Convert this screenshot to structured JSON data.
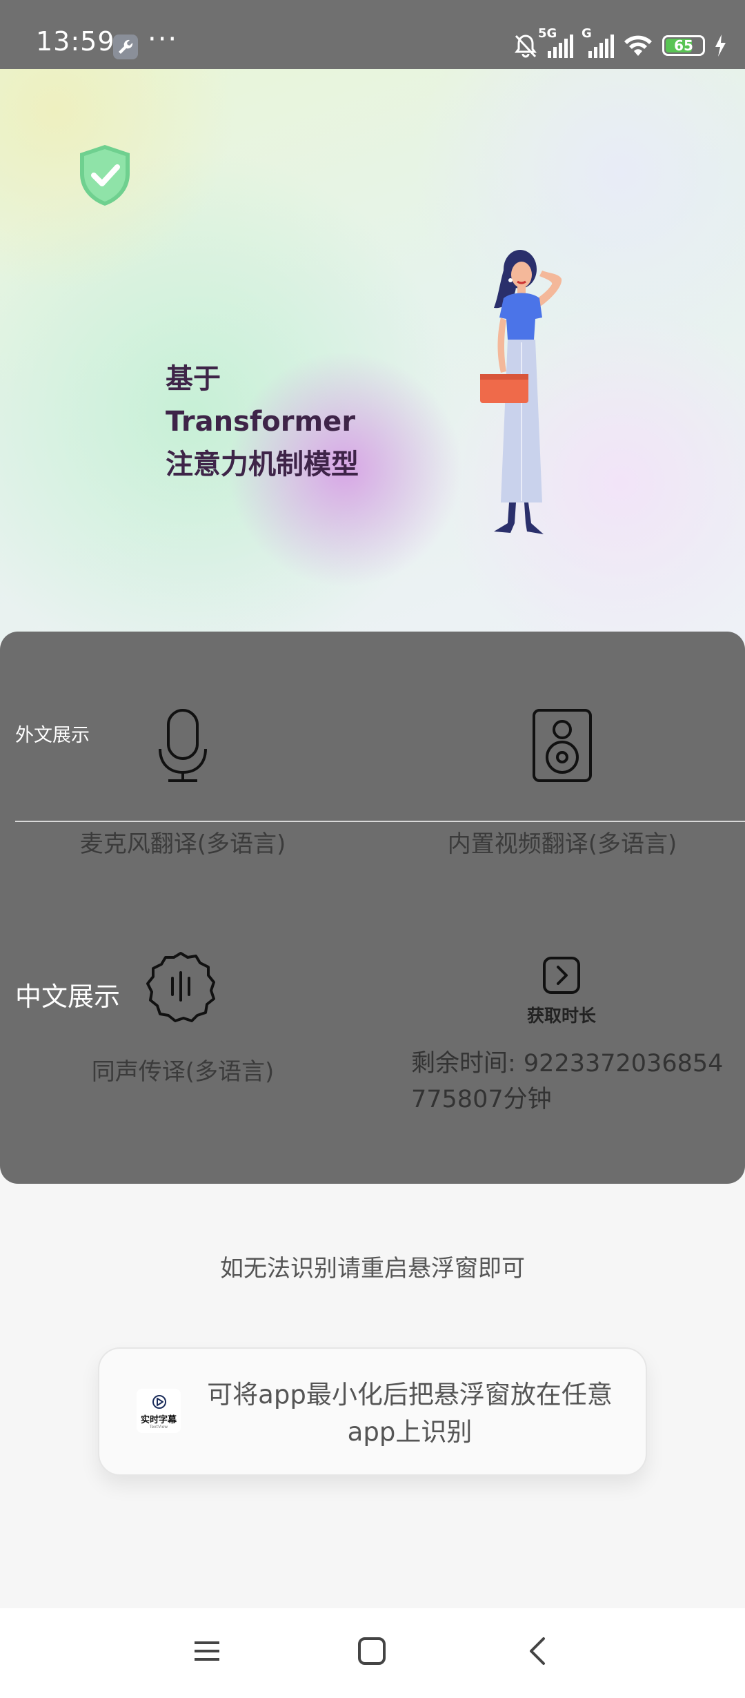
{
  "status_bar": {
    "time": "13:59",
    "network_1": "5G",
    "network_2": "G",
    "battery_level": "65",
    "icons": [
      "wrench-icon",
      "more-dots-icon",
      "mute-bell-icon",
      "signal-icon",
      "wifi-icon",
      "battery-icon",
      "charging-icon"
    ]
  },
  "hero": {
    "headline_line1": "基于",
    "headline_line2": "Transformer",
    "headline_line3": "注意力机制模型"
  },
  "features": {
    "foreign_display_label": "外文展示",
    "mic_translate_label": "麦克风翻译(多语言)",
    "video_translate_label": "内置视频翻译(多语言)",
    "chinese_display_label": "中文展示",
    "simul_translate_label": "同声传译(多语言)",
    "get_duration_label": "获取时长",
    "remaining_time_text": "剩余时间: 9223372036854775807分钟"
  },
  "restart_hint": "如无法识别请重启悬浮窗即可",
  "tip_card": {
    "app_logo_name": "实时字幕",
    "app_logo_sub": "TextView",
    "text": "可将app最小化后把悬浮窗放在任意app上识别"
  },
  "colors": {
    "panel": "#6d6d6d",
    "status_bar": "#707070",
    "headline": "#3e2448",
    "battery_green": "#59c454"
  }
}
